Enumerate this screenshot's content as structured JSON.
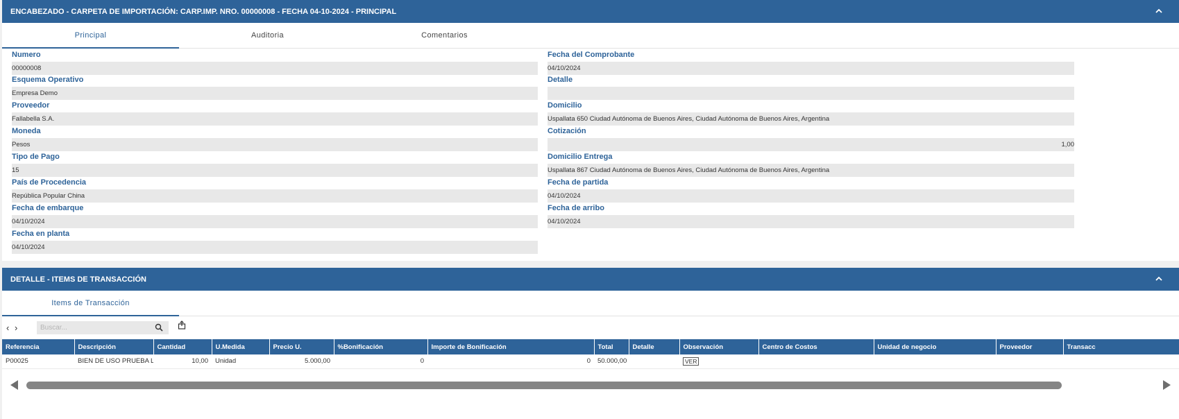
{
  "header_panel": {
    "title": "ENCABEZADO - CARPETA DE IMPORTACIÓN: CARP.IMP. NRO. 00000008 - FECHA 04-10-2024 - PRINCIPAL",
    "tabs": [
      "Principal",
      "Auditoria",
      "Comentarios"
    ],
    "active_tab": "Principal",
    "fields": {
      "numero": {
        "label": "Numero",
        "value": "00000008"
      },
      "esquema": {
        "label": "Esquema Operativo",
        "value": "Empresa Demo"
      },
      "proveedor": {
        "label": "Proveedor",
        "value": "Fallabella S.A."
      },
      "moneda": {
        "label": "Moneda",
        "value": "Pesos"
      },
      "tipo_pago": {
        "label": "Tipo de Pago",
        "value": "15"
      },
      "pais": {
        "label": "País de Procedencia",
        "value": "República Popular China"
      },
      "fecha_embarque": {
        "label": "Fecha de embarque",
        "value": "04/10/2024"
      },
      "fecha_planta": {
        "label": "Fecha en planta",
        "value": "04/10/2024"
      },
      "fecha_comprobante": {
        "label": "Fecha del Comprobante",
        "value": "04/10/2024"
      },
      "detalle": {
        "label": "Detalle",
        "value": ""
      },
      "domicilio": {
        "label": "Domicilio",
        "value": "Uspallata 650  Ciudad Autónoma de Buenos Aires, Ciudad Autónoma de Buenos Aires, Argentina"
      },
      "cotizacion": {
        "label": "Cotización",
        "value": "1,00"
      },
      "domicilio_entrega": {
        "label": "Domicilio Entrega",
        "value": "Uspallata 867  Ciudad Autónoma de Buenos Aires, Ciudad Autónoma de Buenos Aires, Argentina"
      },
      "fecha_partida": {
        "label": "Fecha de partida",
        "value": "04/10/2024"
      },
      "fecha_arribo": {
        "label": "Fecha de arribo",
        "value": "04/10/2024"
      }
    }
  },
  "detail_panel": {
    "title": "DETALLE - ITEMS DE TRANSACCIÓN",
    "tabs": [
      "Items de Transacción"
    ],
    "search_placeholder": "Buscar...",
    "nav_prev": "‹",
    "nav_next": "›",
    "columns": [
      "Referencia",
      "Descripción",
      "Cantidad",
      "U.Medida",
      "Precio U.",
      "%Bonificación",
      "Importe de Bonificación",
      "Total",
      "Detalle",
      "Observación",
      "Centro de Costos",
      "Unidad de negocio",
      "Proveedor",
      "Transacc"
    ],
    "rows": [
      {
        "referencia": "P00025",
        "descripcion": "BIEN DE USO PRUEBA LAC",
        "cantidad": "10,00",
        "umedida": "Unidad",
        "precio": "5.000,00",
        "bonificacion": "0",
        "importe_bonif": "0",
        "total": "50.000,00",
        "detalle": "",
        "observacion": "VER",
        "centro_costos": "",
        "unidad_negocio": "",
        "proveedor": "",
        "transacc": ""
      }
    ]
  },
  "colors": {
    "header_blue": "#2e6399",
    "field_bg": "#e8e8e8"
  },
  "icons": [
    "chevron-up-icon",
    "search-icon",
    "export-icon",
    "chevron-left-icon",
    "chevron-right-icon"
  ]
}
